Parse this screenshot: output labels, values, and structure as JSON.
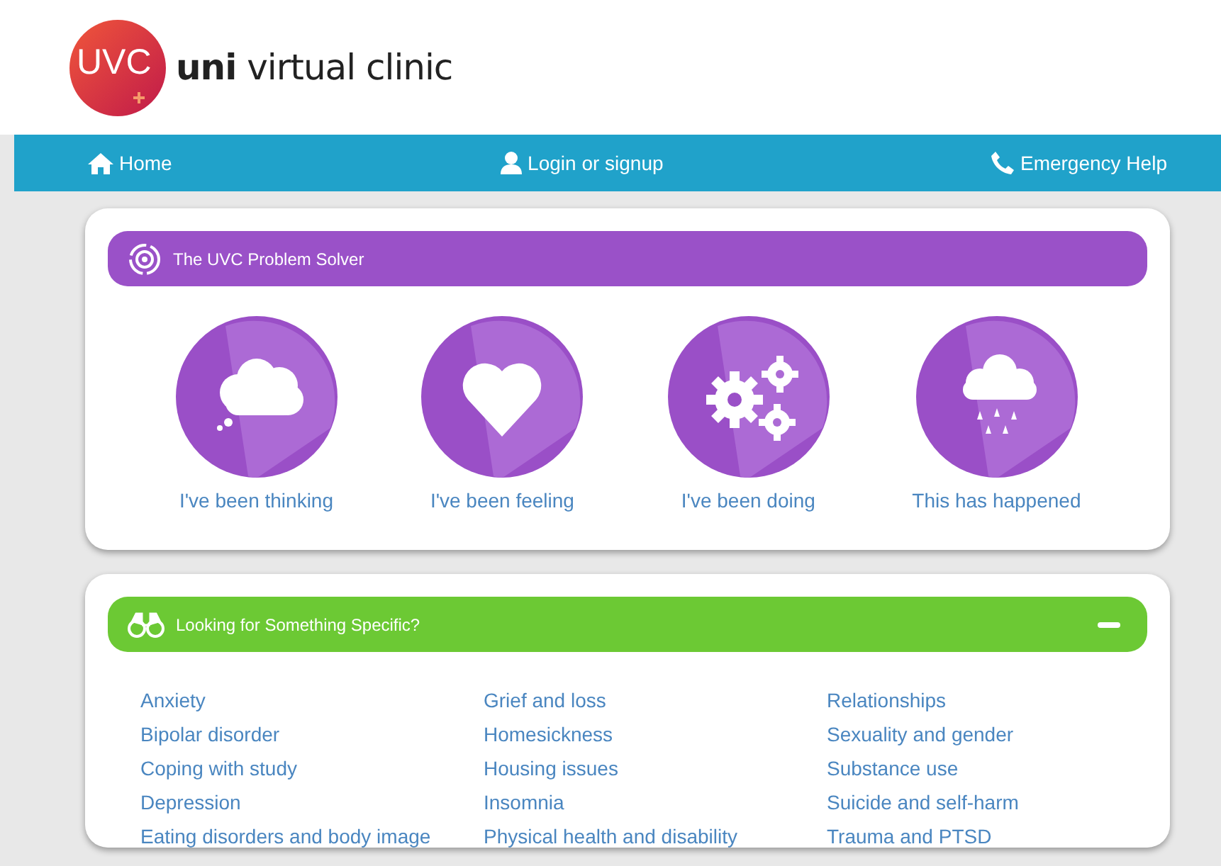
{
  "logo": {
    "badge": "UVC",
    "name_bold": "uni",
    "name_rest": "virtual clinic"
  },
  "nav": [
    {
      "kind": "home",
      "label": "Home"
    },
    {
      "kind": "user",
      "label": "Login or signup"
    },
    {
      "kind": "phone",
      "label": "Emergency Help"
    }
  ],
  "problem_solver": {
    "title": "The UVC Problem Solver",
    "options": [
      {
        "kind": "thought",
        "label": "I've been thinking"
      },
      {
        "kind": "heart",
        "label": "I've been feeling"
      },
      {
        "kind": "gears",
        "label": "I've been doing"
      },
      {
        "kind": "rain",
        "label": "This has happened"
      }
    ]
  },
  "specific": {
    "title": "Looking for Something Specific?",
    "expanded": true,
    "columns": [
      [
        "Anxiety",
        "Bipolar disorder",
        "Coping with study",
        "Depression",
        "Eating disorders and body image"
      ],
      [
        "Grief and loss",
        "Homesickness",
        "Housing issues",
        "Insomnia",
        "Physical health and disability"
      ],
      [
        "Relationships",
        "Sexuality and gender",
        "Substance use",
        "Suicide and self-harm",
        "Trauma and PTSD"
      ]
    ]
  }
}
